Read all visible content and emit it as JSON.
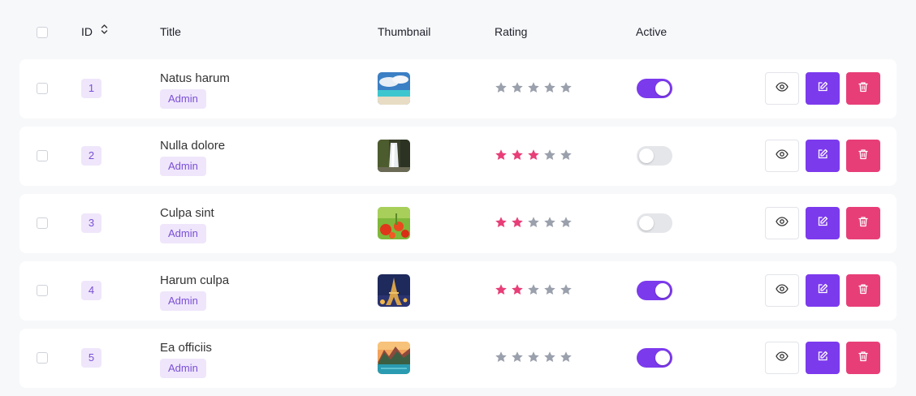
{
  "header": {
    "id_label": "ID",
    "title_label": "Title",
    "thumbnail_label": "Thumbnail",
    "rating_label": "Rating",
    "active_label": "Active"
  },
  "colors": {
    "accent": "#7c3aed",
    "danger": "#e83e78",
    "star_filled": "#e83e78",
    "star_empty": "#9aa0ac"
  },
  "rows": [
    {
      "id": "1",
      "title": "Natus harum",
      "role": "Admin",
      "rating": 0,
      "active": true,
      "thumbnail": "beach-image"
    },
    {
      "id": "2",
      "title": "Nulla dolore",
      "role": "Admin",
      "rating": 3,
      "active": false,
      "thumbnail": "waterfall-image"
    },
    {
      "id": "3",
      "title": "Culpa sint",
      "role": "Admin",
      "rating": 2,
      "active": false,
      "thumbnail": "flowers-image"
    },
    {
      "id": "4",
      "title": "Harum culpa",
      "role": "Admin",
      "rating": 2,
      "active": true,
      "thumbnail": "eiffel-tower-image"
    },
    {
      "id": "5",
      "title": "Ea officiis",
      "role": "Admin",
      "rating": 0,
      "active": true,
      "thumbnail": "mountain-lake-image"
    }
  ]
}
